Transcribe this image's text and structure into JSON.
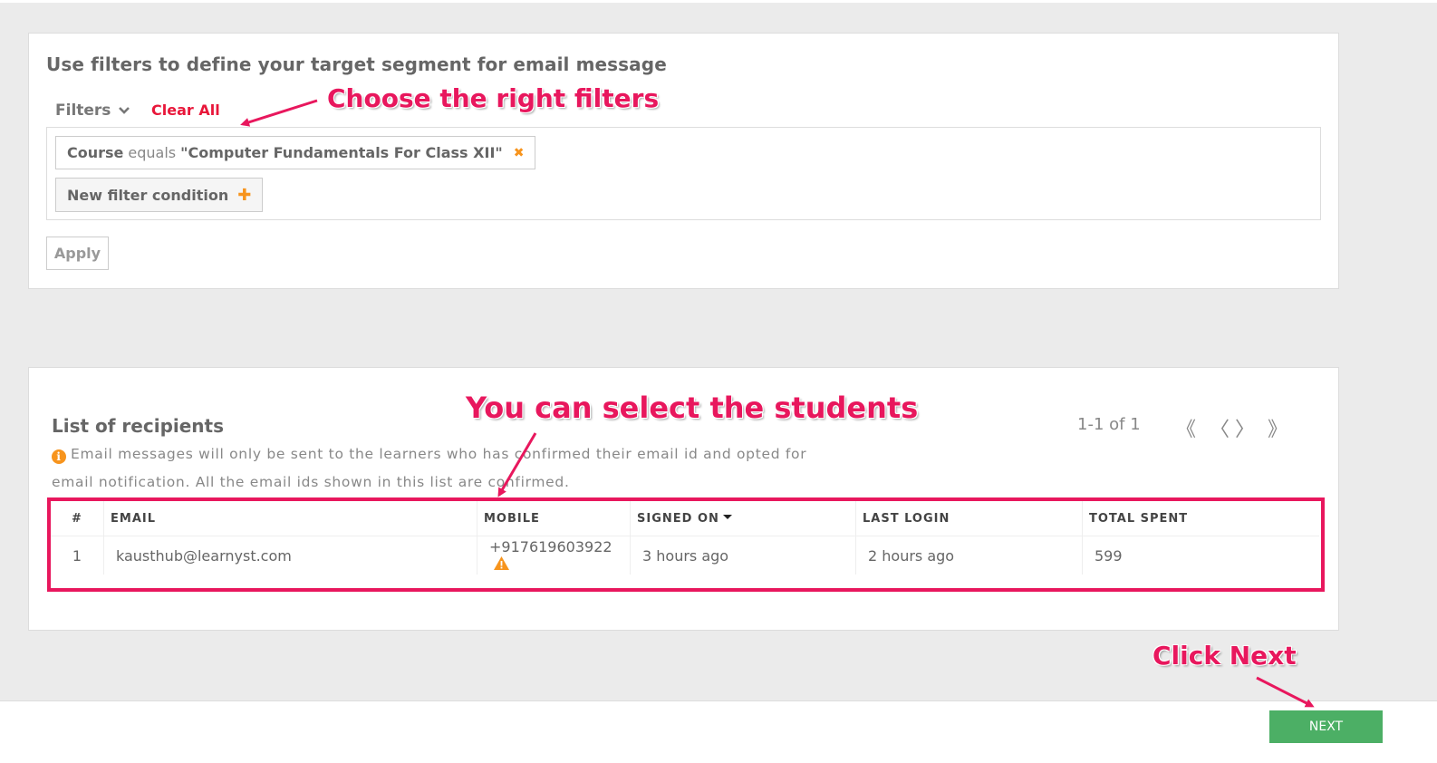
{
  "filters_card": {
    "title": "Use filters to define your target segment for email message",
    "filters_label": "Filters",
    "clear_all": "Clear All",
    "condition": {
      "field": "Course",
      "operator": "equals",
      "value": "\"Computer Fundamentals For Class XII\"",
      "remove": "✖"
    },
    "new_condition": "New filter condition",
    "new_condition_icon": "✚",
    "apply": "Apply"
  },
  "recipients_card": {
    "title": "List of recipients",
    "info_icon": "i",
    "note": "Email messages will only be sent to the learners who has confirmed their email id and opted for email notification. All the email ids shown in this list are confirmed.",
    "page_info": "1-1 of 1",
    "pager": {
      "first": "《",
      "prev": "〈",
      "next": "〉",
      "last": "》"
    },
    "columns": [
      "#",
      "EMAIL",
      "MOBILE",
      "SIGNED ON",
      "LAST LOGIN",
      "TOTAL SPENT"
    ],
    "rows": [
      {
        "num": "1",
        "email": "kausthub@learnyst.com",
        "mobile": "+917619603922",
        "signed_on": "3 hours ago",
        "last_login": "2 hours ago",
        "total_spent": "599"
      }
    ]
  },
  "footer": {
    "next": "NEXT"
  },
  "annotations": {
    "filters": "Choose the right filters",
    "students": "You can select the students",
    "next": "Click Next"
  },
  "colors": {
    "accent": "#e8175d",
    "orange": "#f7941d",
    "green": "#4caf65",
    "clear_red": "#e8173a"
  }
}
